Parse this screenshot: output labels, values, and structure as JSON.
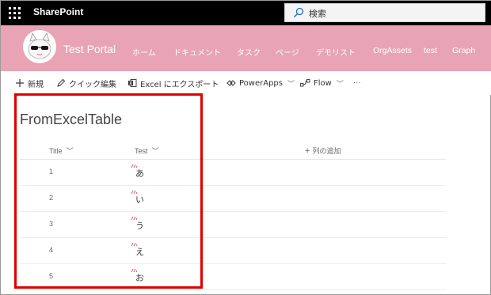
{
  "suitebar": {
    "app_name": "SharePoint",
    "search": {
      "placeholder": "検索"
    }
  },
  "header": {
    "site_title": "Test Portal",
    "nav": [
      "ホーム",
      "ドキュメント",
      "タスク",
      "ページ",
      "デモリスト",
      "OrgAssets",
      "test",
      "Graph"
    ]
  },
  "commands": {
    "new": "新規",
    "quick_edit": "クイック編集",
    "export": "Excel にエクスポート",
    "powerapps": "PowerApps",
    "flow": "Flow",
    "more": "···"
  },
  "list": {
    "title": "FromExcelTable",
    "columns": {
      "title": "Title",
      "test": "Test",
      "add": "列の追加"
    },
    "rows": [
      {
        "title": "1",
        "test": "あ"
      },
      {
        "title": "2",
        "test": "い"
      },
      {
        "title": "3",
        "test": "う"
      },
      {
        "title": "4",
        "test": "え"
      },
      {
        "title": "5",
        "test": "お"
      }
    ]
  },
  "colors": {
    "suitebar": "#000000",
    "header": "#e8a3b4",
    "highlight": "#e00000",
    "new_marker": "#d04a7a"
  }
}
